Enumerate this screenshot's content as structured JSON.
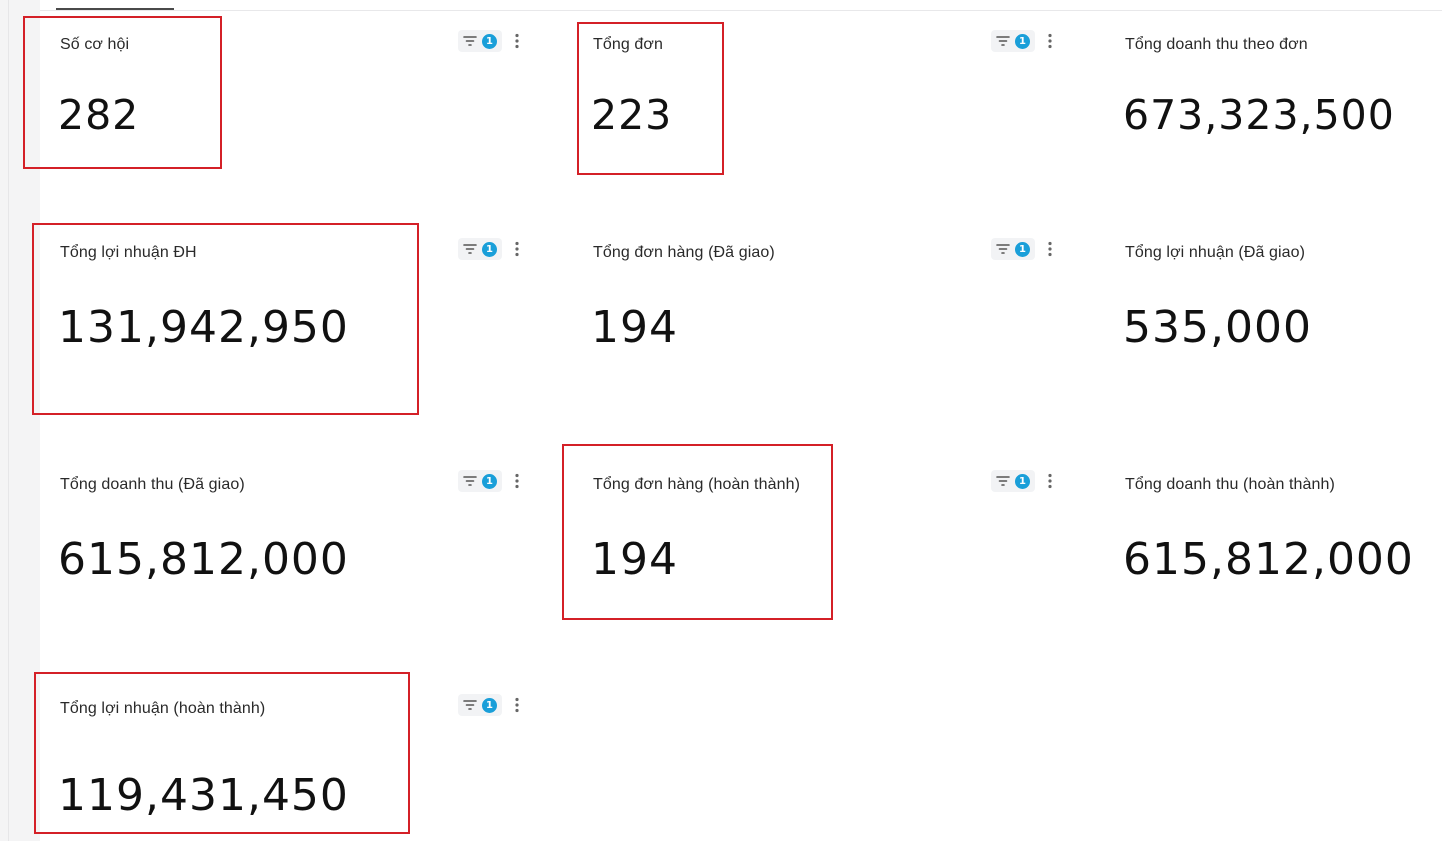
{
  "cards": [
    {
      "title": "Số cơ hội",
      "value": "282",
      "filter_count": "1"
    },
    {
      "title": "Tổng đơn",
      "value": "223",
      "filter_count": "1"
    },
    {
      "title": "Tổng doanh thu theo đơn",
      "value": "673,323,500"
    },
    {
      "title": "Tổng lợi nhuận ĐH",
      "value": "131,942,950",
      "filter_count": "1"
    },
    {
      "title": "Tổng đơn hàng (Đã giao)",
      "value": "194",
      "filter_count": "1"
    },
    {
      "title": "Tổng lợi nhuận (Đã giao)",
      "value": "535,000"
    },
    {
      "title": "Tổng doanh thu (Đã giao)",
      "value": "615,812,000",
      "filter_count": "1"
    },
    {
      "title": "Tổng đơn hàng (hoàn thành)",
      "value": "194",
      "filter_count": "1"
    },
    {
      "title": "Tổng doanh thu (hoàn thành)",
      "value": "615,812,000"
    },
    {
      "title": "Tổng lợi nhuận (hoàn thành)",
      "value": "119,431,450",
      "filter_count": "1"
    }
  ],
  "colors": {
    "highlight": "#d42027",
    "badge": "#1a9fd9"
  },
  "icons": {
    "filter": "filter-icon",
    "more": "more-vertical-icon"
  }
}
